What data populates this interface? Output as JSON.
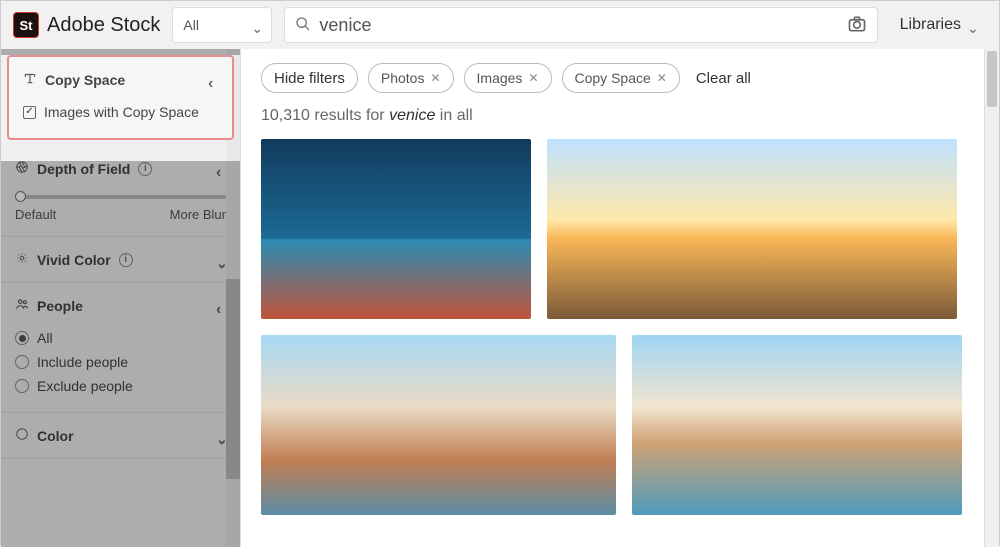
{
  "header": {
    "brand_logo_text": "St",
    "brand_name": "Adobe Stock",
    "category_label": "All",
    "search_value": "venice",
    "search_placeholder": "",
    "libraries_label": "Libraries"
  },
  "sidebar": {
    "copy_space": {
      "title": "Copy Space",
      "checkbox_label": "Images with Copy Space",
      "checked": true
    },
    "depth": {
      "title": "Depth of Field",
      "labels": {
        "left": "Default",
        "right": "More Blur"
      }
    },
    "vivid": {
      "title": "Vivid Color"
    },
    "people": {
      "title": "People",
      "options": [
        "All",
        "Include people",
        "Exclude people"
      ],
      "selected": 0
    },
    "color": {
      "title": "Color"
    }
  },
  "chips": {
    "hide_label": "Hide filters",
    "items": [
      "Photos",
      "Images",
      "Copy Space"
    ],
    "clear_label": "Clear all"
  },
  "results": {
    "count": "10,310",
    "prefix": "results for",
    "term": "venice",
    "suffix": "in all"
  }
}
